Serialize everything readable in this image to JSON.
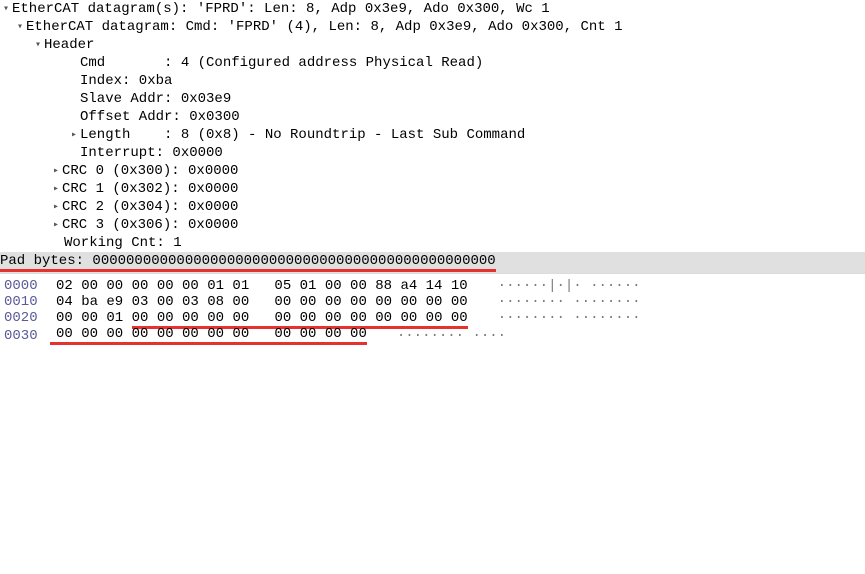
{
  "tree": {
    "line0": "EtherCAT datagram(s): 'FPRD': Len: 8, Adp 0x3e9, Ado 0x300, Wc 1",
    "line1": "EtherCAT datagram: Cmd: 'FPRD' (4), Len: 8, Adp 0x3e9, Ado 0x300, Cnt 1",
    "header_label": "Header",
    "cmd": "Cmd       : 4 (Configured address Physical Read)",
    "index": "Index: 0xba",
    "slave": "Slave Addr: 0x03e9",
    "offset": "Offset Addr: 0x0300",
    "length": "Length    : 8 (0x8) - No Roundtrip - Last Sub Command",
    "interrupt": "Interrupt: 0x0000",
    "crc0": "CRC 0 (0x300): 0x0000",
    "crc1": "CRC 1 (0x302): 0x0000",
    "crc2": "CRC 2 (0x304): 0x0000",
    "crc3": "CRC 3 (0x306): 0x0000",
    "wc": "Working Cnt: 1",
    "pad": "Pad bytes: 000000000000000000000000000000000000000000000000"
  },
  "hex": {
    "r0": {
      "off": "0000",
      "b": "02 00 00 00 00 00 01 01   05 01 00 00 88 a4 14 10",
      "a": "······|·|· ······"
    },
    "r1": {
      "off": "0010",
      "b": "04 ba e9 03 00 03 08 00   00 00 00 00 00 00 00 00",
      "a": "········ ········"
    },
    "r2": {
      "off": "0020",
      "b": "00 00 01 00 00 00 00 00   00 00 00 00 00 00 00 00",
      "a": "········ ········"
    },
    "r3": {
      "off": "0030",
      "b": "00 00 00 00 00 00 00 00   00 00 00 00",
      "a": "········ ····"
    }
  }
}
